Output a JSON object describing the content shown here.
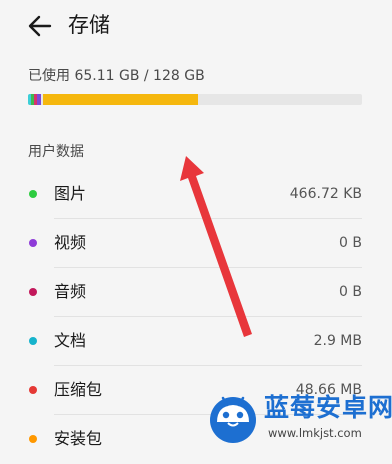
{
  "header": {
    "title": "存储"
  },
  "usage": {
    "text": "已使用 65.11 GB / 128 GB",
    "used_fraction": 0.5087,
    "segments": [
      {
        "name": "category-a",
        "color": "#3ccfd8"
      },
      {
        "name": "category-b",
        "color": "#3fb950"
      },
      {
        "name": "category-c",
        "color": "#d6336c"
      },
      {
        "name": "category-d",
        "color": "#7b4bd6"
      },
      {
        "name": "main",
        "color": "#f5b70e"
      }
    ],
    "track_color": "#e6e6e6"
  },
  "section": {
    "title": "用户数据"
  },
  "items": [
    {
      "label": "图片",
      "value": "466.72 KB",
      "color": "#2ecc40"
    },
    {
      "label": "视频",
      "value": "0 B",
      "color": "#8e3bd8"
    },
    {
      "label": "音频",
      "value": "0 B",
      "color": "#c2185b"
    },
    {
      "label": "文档",
      "value": "2.9 MB",
      "color": "#16b3cc"
    },
    {
      "label": "压缩包",
      "value": "48.66 MB",
      "color": "#e53935"
    },
    {
      "label": "安装包",
      "value": "",
      "color": "#ff9800"
    }
  ],
  "icons": {
    "back": "arrow-left-icon",
    "annotation": "red-arrow-icon",
    "logo": "robot-logo-icon"
  },
  "watermark": {
    "name": "蓝莓安卓网",
    "url": "www.lmkjst.com"
  },
  "colors": {
    "annotation": "#e8363b",
    "watermark": "#1d6fd1"
  }
}
